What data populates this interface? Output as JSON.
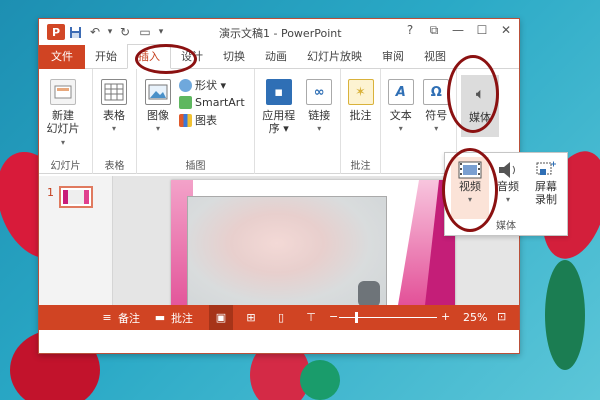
{
  "app": {
    "window_title": "演示文稿1 - PowerPoint",
    "logo_letter": "P",
    "controls": {
      "help": "?",
      "ribbon_options": "⧉",
      "minimize": "—",
      "maximize": "☐",
      "close": "✕"
    }
  },
  "quick_access": {
    "save_icon": "floppy-disk-icon",
    "undo": "↶",
    "undo_dropdown": "▾",
    "redo": "↻",
    "start": "▭",
    "customize": "▾"
  },
  "tabs": [
    "文件",
    "开始",
    "插入",
    "设计",
    "切换",
    "动画",
    "幻灯片放映",
    "审阅",
    "视图"
  ],
  "active_tab": "插入",
  "ribbon_groups": {
    "slides": {
      "label": "幻灯片",
      "new_slide": {
        "line1": "新建",
        "line2": "幻灯片",
        "arrow": "▾"
      }
    },
    "tables": {
      "label": "表格",
      "table": {
        "label": "表格",
        "arrow": "▾"
      }
    },
    "images": {
      "label": "插图",
      "picture": {
        "label": "图像",
        "arrow": "▾"
      },
      "shapes": "形状 ▾",
      "smartart": "SmartArt",
      "chart": "图表"
    },
    "apps": {
      "label": "",
      "apps_btn": {
        "line1": "应用程",
        "line2": "序 ▾"
      },
      "links": {
        "label": "链接",
        "arrow": "▾"
      }
    },
    "comments": {
      "label": "批注",
      "comment": "批注"
    },
    "text_sym": {
      "label": "",
      "text": {
        "label": "文本",
        "arrow": "▾"
      },
      "symbols": {
        "label": "符号",
        "arrow": "▾"
      }
    },
    "media": {
      "label": "",
      "media": "媒体",
      "collapse": "^"
    }
  },
  "media_flyout": {
    "video": {
      "label": "视频",
      "arrow": "▾"
    },
    "audio": {
      "label": "音频",
      "arrow": "▾"
    },
    "screen_recording": {
      "line1": "屏幕",
      "line2": "录制"
    },
    "group_label": "媒体"
  },
  "slides_pane": {
    "slide_number": "1"
  },
  "statusbar": {
    "notes": "备注",
    "comments": "批注",
    "zoom_minus": "−",
    "zoom_plus": "+",
    "zoom": "25%",
    "zoom_level_percent": 25
  },
  "colors": {
    "accent": "#d04423",
    "highlight_ring": "#8b1111"
  }
}
